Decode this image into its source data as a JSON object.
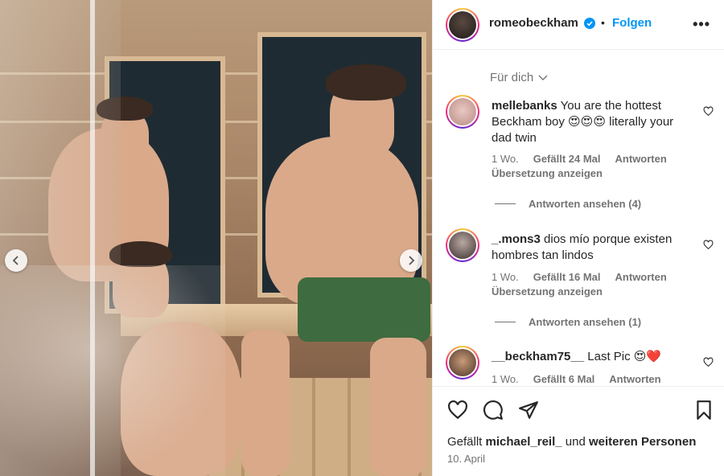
{
  "post": {
    "username": "romeobeckham",
    "separator": "•",
    "follow_label": "Folgen",
    "more_label": "•••"
  },
  "comments_filter": {
    "label": "Für dich"
  },
  "comments": [
    {
      "username": "mellebanks",
      "text": "You are the hottest Beckham boy 😍😍😍 literally your dad twin",
      "time": "1 Wo.",
      "likes": "Gefällt 24 Mal",
      "reply_label": "Antworten",
      "translate_label": "Übersetzung anzeigen",
      "view_replies": "Antworten ansehen (4)"
    },
    {
      "username": "_.mons3",
      "text": "dios mío porque existen hombres tan lindos",
      "time": "1 Wo.",
      "likes": "Gefällt 16 Mal",
      "reply_label": "Antworten",
      "translate_label": "Übersetzung anzeigen",
      "view_replies": "Antworten ansehen (1)"
    },
    {
      "username": "__beckham75__",
      "text": "Last Pic 😍❤️",
      "time": "1 Wo.",
      "likes": "Gefällt 6 Mal",
      "reply_label": "Antworten"
    }
  ],
  "footer": {
    "likes_prefix": "Gefällt",
    "likes_user": "michael_reil_",
    "likes_middle": "und",
    "likes_others": "weiteren Personen",
    "date": "10. April"
  },
  "icons": {
    "verified": "verified-badge-icon",
    "like": "heart-icon",
    "comment": "comment-icon",
    "share": "paper-plane-icon",
    "save": "bookmark-icon"
  },
  "colors": {
    "accent": "#0095f6",
    "verified": "#0095f6",
    "text": "#262626",
    "muted": "#737373"
  }
}
